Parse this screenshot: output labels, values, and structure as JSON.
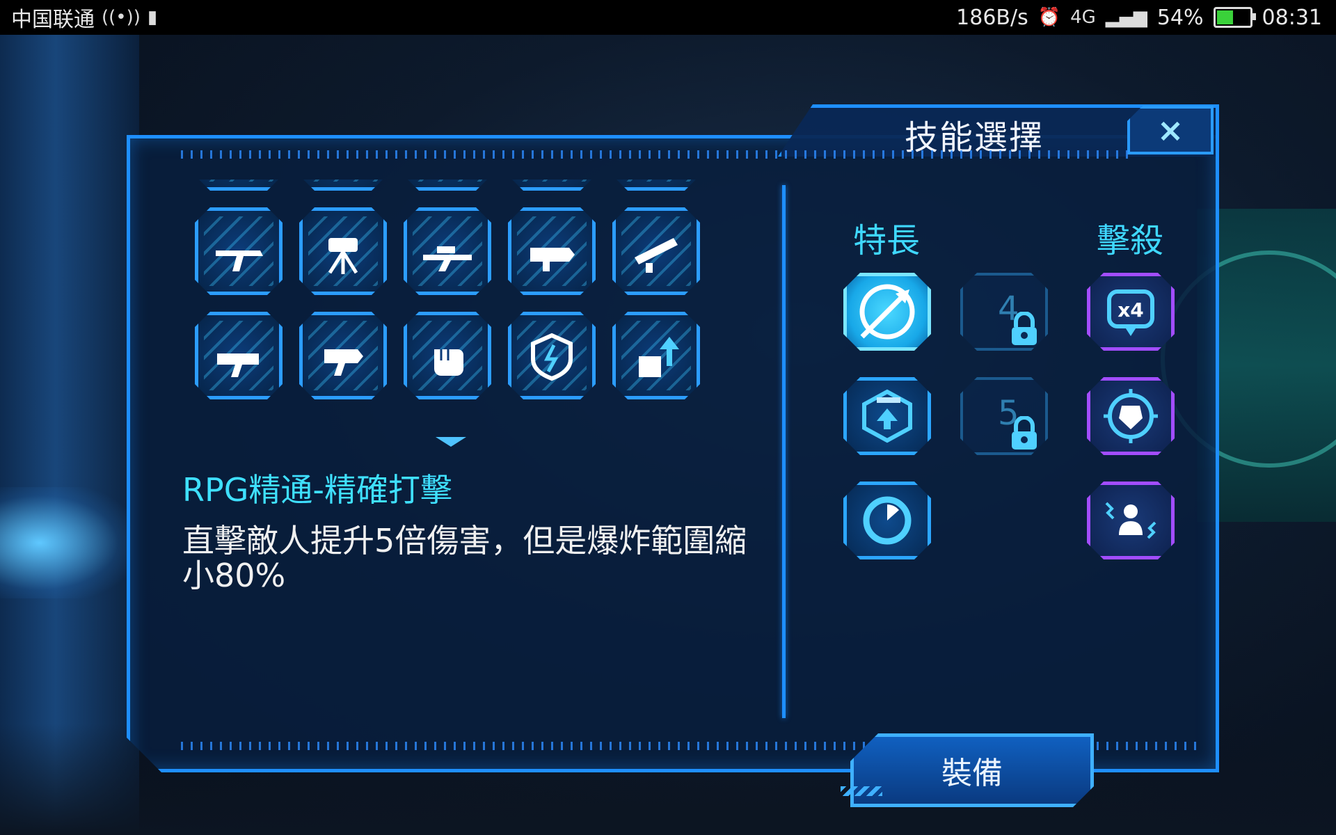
{
  "status_bar": {
    "carrier": "中国联通",
    "network_speed": "186B/s",
    "battery_percent": "54%",
    "time": "08:31",
    "battery_level": 0.54
  },
  "dialog": {
    "title": "技能選擇",
    "close_label": "×"
  },
  "skill_grid": {
    "rows": [
      [
        "pistol-icon",
        "smg-icon",
        "shotgun-icon",
        "knife-icon",
        "rifle-icon"
      ],
      [
        "assault-rifle-icon",
        "turret-icon",
        "sniper-icon",
        "rpg-icon",
        "lmg-icon"
      ],
      [
        "heavy-gun-icon",
        "blaster-icon",
        "melee-fist-icon",
        "shield-icon",
        "strength-up-icon"
      ]
    ]
  },
  "selected_skill": {
    "name": "RPG精通-精確打擊",
    "description": "直擊敵人提升5倍傷害，但是爆炸範圍縮小80%"
  },
  "perks": {
    "header": "特長",
    "slots": [
      {
        "icon": "precision-shot-icon",
        "state": "active"
      },
      {
        "icon": "weapon-upgrade-icon",
        "state": "normal"
      },
      {
        "icon": "cooldown-timer-icon",
        "state": "normal"
      }
    ],
    "locked": [
      {
        "level": "4"
      },
      {
        "level": "5"
      }
    ]
  },
  "killstreaks": {
    "header": "擊殺",
    "slots": [
      {
        "icon": "x4-killstreak-icon",
        "label": "x4"
      },
      {
        "icon": "target-armor-icon",
        "label": ""
      },
      {
        "icon": "player-shock-icon",
        "label": ""
      }
    ]
  },
  "equip_label": "裝備",
  "colors": {
    "accent": "#1e8fff",
    "cyan_text": "#3fe0ff",
    "purple": "#a24dff"
  }
}
